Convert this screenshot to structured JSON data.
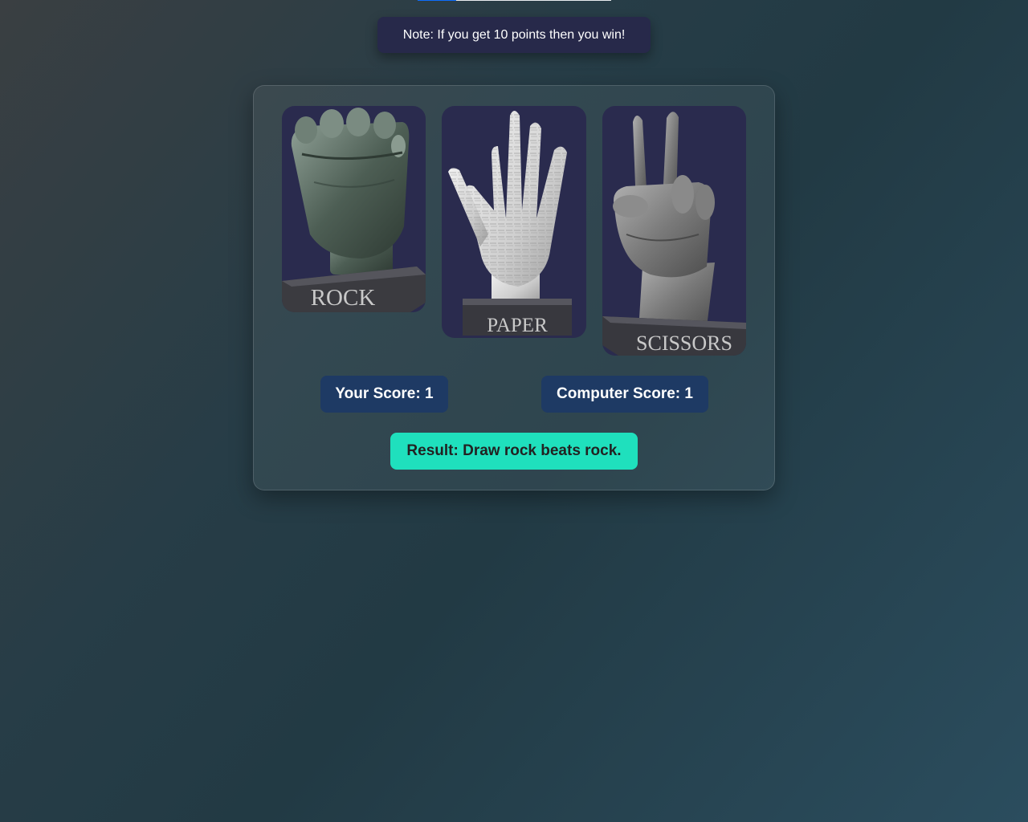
{
  "progress": {
    "fraction": 0.2
  },
  "note": {
    "text": "Note: If you get 10 points then you win!"
  },
  "choices": [
    {
      "id": "rock",
      "label": "ROCK"
    },
    {
      "id": "paper",
      "label": "PAPER"
    },
    {
      "id": "scissors",
      "label": "SCISSORS"
    }
  ],
  "scores": {
    "user": "Your Score: 1",
    "computer": "Computer Score: 1"
  },
  "result": {
    "text": "Result: Draw rock beats rock."
  },
  "colors": {
    "note_bg": "#27294a",
    "card_bg": "#2a2b4e",
    "score_bg": "#1e3a64",
    "result_bg": "#1fe0bd",
    "progress_fill": "#0d6efd"
  }
}
